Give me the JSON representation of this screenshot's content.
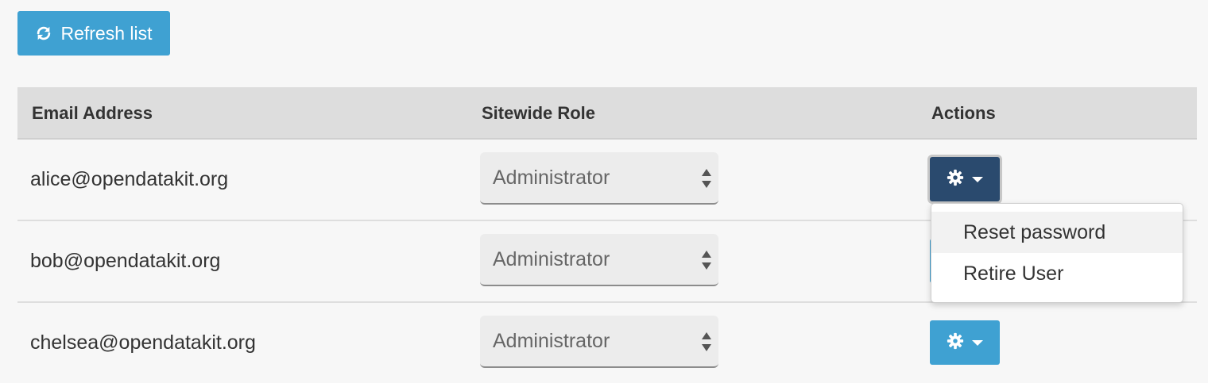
{
  "toolbar": {
    "refresh_label": "Refresh list"
  },
  "table": {
    "headers": {
      "email": "Email Address",
      "role": "Sitewide Role",
      "actions": "Actions"
    },
    "rows": [
      {
        "email": "alice@opendatakit.org",
        "role": "Administrator"
      },
      {
        "email": "bob@opendatakit.org",
        "role": "Administrator"
      },
      {
        "email": "chelsea@opendatakit.org",
        "role": "Administrator"
      }
    ]
  },
  "actions_menu": {
    "open_for_row": 0,
    "items": [
      "Reset password",
      "Retire User"
    ],
    "highlighted_item": 0
  },
  "colors": {
    "primary": "#3fa1d2",
    "primary_active": "#2a4a6e",
    "header_bg": "#dddddd",
    "page_bg": "#f7f7f7"
  },
  "icons": {
    "refresh": "refresh-icon",
    "actions": "gear-icon",
    "dropdown": "caret-down-icon",
    "select": "select-arrows-icon"
  }
}
